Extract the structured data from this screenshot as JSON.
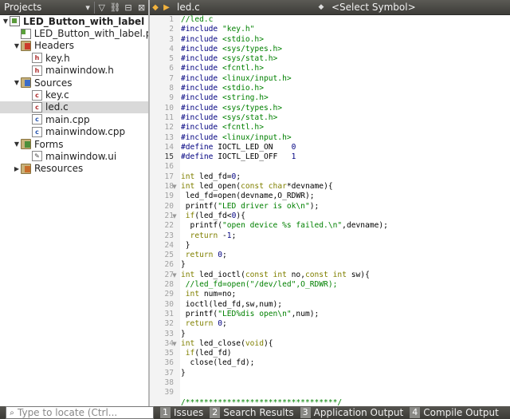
{
  "projects": {
    "title": "Projects",
    "header_icons": [
      "filter-icon",
      "link-icon",
      "split-icon",
      "close-icon"
    ],
    "tree": [
      {
        "label": "LED_Button_with_label",
        "level": 0,
        "icon": "project",
        "expanded": true,
        "bold": true
      },
      {
        "label": "LED_Button_with_label.p",
        "level": 1,
        "icon": "pro"
      },
      {
        "label": "Headers",
        "level": 1,
        "icon": "folder-h",
        "expanded": true
      },
      {
        "label": "key.h",
        "level": 2,
        "icon": "h"
      },
      {
        "label": "mainwindow.h",
        "level": 2,
        "icon": "h"
      },
      {
        "label": "Sources",
        "level": 1,
        "icon": "folder-s",
        "expanded": true
      },
      {
        "label": "key.c",
        "level": 2,
        "icon": "c"
      },
      {
        "label": "led.c",
        "level": 2,
        "icon": "c",
        "selected": true
      },
      {
        "label": "main.cpp",
        "level": 2,
        "icon": "cpp"
      },
      {
        "label": "mainwindow.cpp",
        "level": 2,
        "icon": "cpp"
      },
      {
        "label": "Forms",
        "level": 1,
        "icon": "folder-f",
        "expanded": true
      },
      {
        "label": "mainwindow.ui",
        "level": 2,
        "icon": "ui"
      },
      {
        "label": "Resources",
        "level": 1,
        "icon": "folder-r",
        "expanded": false
      }
    ]
  },
  "editor": {
    "file_name": "led.c",
    "symbol_placeholder": "<Select Symbol>",
    "current_line": 15,
    "colors": {
      "comment": "#008000",
      "keyword": "#808000",
      "string": "#008000",
      "number": "#000080",
      "preproc": "#000080"
    },
    "lines": [
      [
        [
          "//led.c",
          "comment"
        ]
      ],
      [
        [
          "#include ",
          "preproc"
        ],
        [
          "\"key.h\"",
          "string"
        ]
      ],
      [
        [
          "#include ",
          "preproc"
        ],
        [
          "<stdio.h>",
          "string"
        ]
      ],
      [
        [
          "#include ",
          "preproc"
        ],
        [
          "<sys/types.h>",
          "string"
        ]
      ],
      [
        [
          "#include ",
          "preproc"
        ],
        [
          "<sys/stat.h>",
          "string"
        ]
      ],
      [
        [
          "#include ",
          "preproc"
        ],
        [
          "<fcntl.h>",
          "string"
        ]
      ],
      [
        [
          "#include ",
          "preproc"
        ],
        [
          "<linux/input.h>",
          "string"
        ]
      ],
      [
        [
          "#include ",
          "preproc"
        ],
        [
          "<stdio.h>",
          "string"
        ]
      ],
      [
        [
          "#include ",
          "preproc"
        ],
        [
          "<string.h>",
          "string"
        ]
      ],
      [
        [
          "#include ",
          "preproc"
        ],
        [
          "<sys/types.h>",
          "string"
        ]
      ],
      [
        [
          "#include ",
          "preproc"
        ],
        [
          "<sys/stat.h>",
          "string"
        ]
      ],
      [
        [
          "#include ",
          "preproc"
        ],
        [
          "<fcntl.h>",
          "string"
        ]
      ],
      [
        [
          "#include ",
          "preproc"
        ],
        [
          "<linux/input.h>",
          "string"
        ]
      ],
      [
        [
          "#define ",
          "preproc"
        ],
        [
          "IOCTL_LED_ON    ",
          "plain"
        ],
        [
          "0",
          "number"
        ]
      ],
      [
        [
          "#define ",
          "preproc"
        ],
        [
          "IOCTL_LED_OFF   ",
          "plain"
        ],
        [
          "1",
          "number"
        ]
      ],
      [],
      [
        [
          "int",
          "keyword"
        ],
        [
          " led_fd=",
          "plain"
        ],
        [
          "0",
          "number"
        ],
        [
          ";",
          "plain"
        ]
      ],
      [
        [
          "int",
          "keyword"
        ],
        [
          " led_open(",
          "plain"
        ],
        [
          "const",
          "keyword"
        ],
        [
          " ",
          "plain"
        ],
        [
          "char",
          "keyword"
        ],
        [
          "*devname){",
          "plain"
        ]
      ],
      [
        [
          " led_fd=open(devname,O_RDWR);",
          "plain"
        ]
      ],
      [
        [
          " printf(",
          "plain"
        ],
        [
          "\"LED driver is ok\\n\"",
          "string"
        ],
        [
          ");",
          "plain"
        ]
      ],
      [
        [
          " ",
          "plain"
        ],
        [
          "if",
          "keyword"
        ],
        [
          "(led_fd<",
          "plain"
        ],
        [
          "0",
          "number"
        ],
        [
          "){",
          "plain"
        ]
      ],
      [
        [
          "  printf(",
          "plain"
        ],
        [
          "\"open device %s failed.\\n\"",
          "string"
        ],
        [
          ",devname);",
          "plain"
        ]
      ],
      [
        [
          "  ",
          "plain"
        ],
        [
          "return",
          "keyword"
        ],
        [
          " -",
          "plain"
        ],
        [
          "1",
          "number"
        ],
        [
          ";",
          "plain"
        ]
      ],
      [
        [
          " }",
          "plain"
        ]
      ],
      [
        [
          " ",
          "plain"
        ],
        [
          "return",
          "keyword"
        ],
        [
          " ",
          "plain"
        ],
        [
          "0",
          "number"
        ],
        [
          ";",
          "plain"
        ]
      ],
      [
        [
          "}",
          "plain"
        ]
      ],
      [
        [
          "int",
          "keyword"
        ],
        [
          " led_ioctl(",
          "plain"
        ],
        [
          "const",
          "keyword"
        ],
        [
          " ",
          "plain"
        ],
        [
          "int",
          "keyword"
        ],
        [
          " no,",
          "plain"
        ],
        [
          "const",
          "keyword"
        ],
        [
          " ",
          "plain"
        ],
        [
          "int",
          "keyword"
        ],
        [
          " sw){",
          "plain"
        ]
      ],
      [
        [
          " //led_fd=open(\"/dev/led\",O_RDWR);",
          "comment"
        ]
      ],
      [
        [
          " ",
          "plain"
        ],
        [
          "int",
          "keyword"
        ],
        [
          " num=no;",
          "plain"
        ]
      ],
      [
        [
          " ioctl(led_fd,sw,num);",
          "plain"
        ]
      ],
      [
        [
          " printf(",
          "plain"
        ],
        [
          "\"LED%dis open\\n\"",
          "string"
        ],
        [
          ",num);",
          "plain"
        ]
      ],
      [
        [
          " ",
          "plain"
        ],
        [
          "return",
          "keyword"
        ],
        [
          " ",
          "plain"
        ],
        [
          "0",
          "number"
        ],
        [
          ";",
          "plain"
        ]
      ],
      [
        [
          "}",
          "plain"
        ]
      ],
      [
        [
          "int",
          "keyword"
        ],
        [
          " led_close(",
          "plain"
        ],
        [
          "void",
          "keyword"
        ],
        [
          "){",
          "plain"
        ]
      ],
      [
        [
          " ",
          "plain"
        ],
        [
          "if",
          "keyword"
        ],
        [
          "(led_fd)",
          "plain"
        ]
      ],
      [
        [
          "  close(led_fd);",
          "plain"
        ]
      ],
      [
        [
          "}",
          "plain"
        ]
      ],
      [],
      [],
      [
        [
          "/*********************************/",
          "comment"
        ]
      ]
    ],
    "line_numbers": [
      "1",
      "2",
      "3",
      "4",
      "5",
      "6",
      "7",
      "8",
      "9",
      "10",
      "11",
      "12",
      "13",
      "14",
      "15",
      "16",
      "17",
      "18",
      "19",
      "20",
      "21",
      "22",
      "23",
      "24",
      "25",
      "26",
      "27",
      "28",
      "29",
      "30",
      "31",
      "32",
      "33",
      "34",
      "35",
      "36",
      "37",
      "38",
      "39"
    ],
    "fold_lines": [
      18,
      21,
      27,
      34
    ]
  },
  "bottom": {
    "locate_placeholder": "Type to locate (Ctrl...",
    "tabs": [
      {
        "num": "1",
        "label": "Issues"
      },
      {
        "num": "2",
        "label": "Search Results"
      },
      {
        "num": "3",
        "label": "Application Output"
      },
      {
        "num": "4",
        "label": "Compile Output"
      }
    ]
  }
}
